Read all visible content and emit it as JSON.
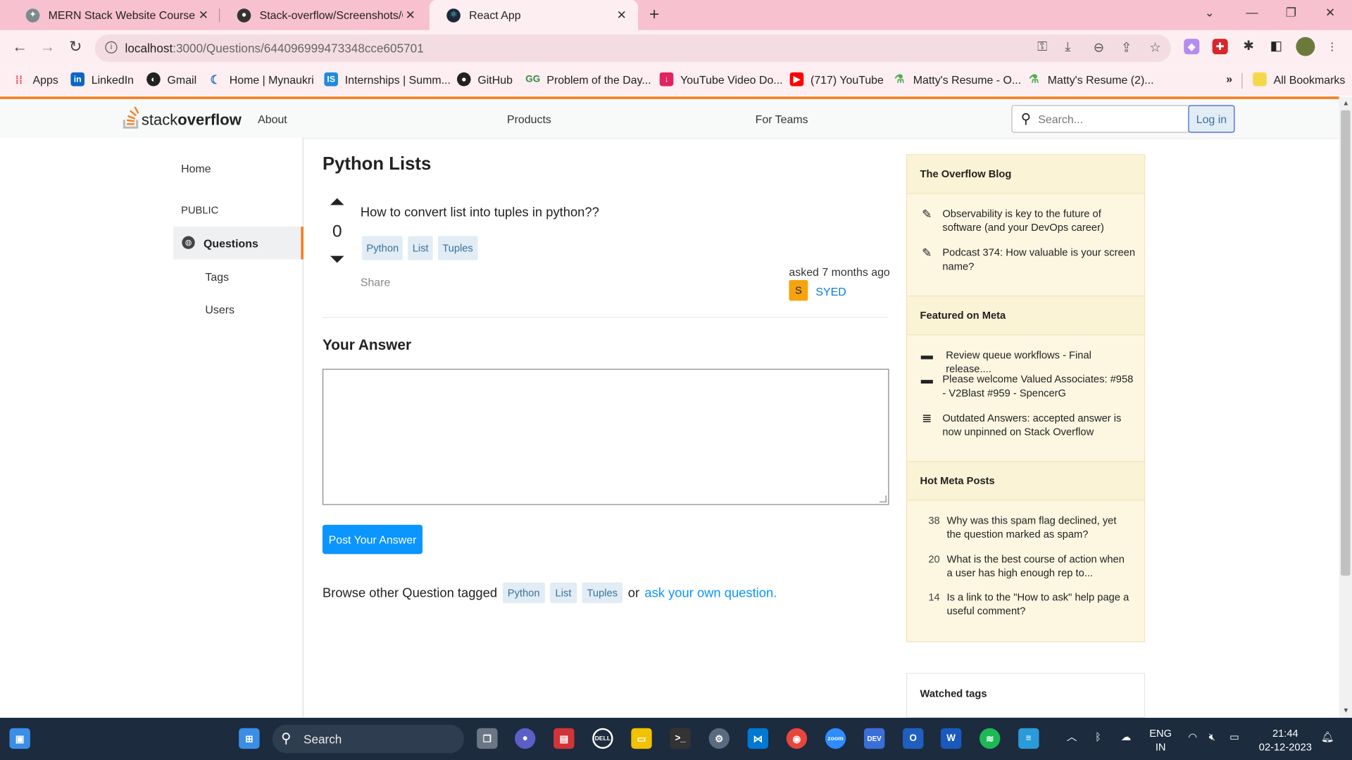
{
  "browser": {
    "tabs": [
      {
        "label": "MERN Stack Website Course",
        "active": false
      },
      {
        "label": "Stack-overflow/Screenshots/Qu",
        "active": false
      },
      {
        "label": "React App",
        "active": true
      }
    ],
    "url_host": "localhost",
    "url_path": ":3000/Questions/644096999473348cce605701",
    "bookmarks": [
      {
        "label": "Apps",
        "icon": "apps-grid-icon"
      },
      {
        "label": "LinkedIn",
        "icon": "linkedin-icon"
      },
      {
        "label": "Gmail",
        "icon": "gmail-icon"
      },
      {
        "label": "Home | Mynaukri",
        "icon": "mynaukri-icon"
      },
      {
        "label": "Internships | Summ...",
        "icon": "internshala-icon"
      },
      {
        "label": "GitHub",
        "icon": "github-icon"
      },
      {
        "label": "Problem of the Day...",
        "icon": "gfg-icon"
      },
      {
        "label": "YouTube Video Do...",
        "icon": "download-icon"
      },
      {
        "label": "(717) YouTube",
        "icon": "youtube-icon"
      },
      {
        "label": "Matty's Resume - O...",
        "icon": "resume-icon"
      },
      {
        "label": "Matty's Resume (2)...",
        "icon": "resume-icon"
      }
    ],
    "all_bookmarks": "All Bookmarks"
  },
  "so_nav": {
    "logo_stack": "stack",
    "logo_overflow": "overflow",
    "about": "About",
    "products": "Products",
    "for_teams": "For Teams",
    "search_placeholder": "Search...",
    "login": "Log in"
  },
  "left_nav": {
    "home": "Home",
    "public": "PUBLIC",
    "questions": "Questions",
    "tags": "Tags",
    "users": "Users"
  },
  "question": {
    "title": "Python Lists",
    "votes": "0",
    "body": "How to convert list into tuples in python??",
    "tags": [
      "Python",
      "List",
      "Tuples"
    ],
    "share": "Share",
    "asked": "asked 7 months ago",
    "user_initial": "S",
    "user_name": "SYED"
  },
  "answer": {
    "heading": "Your Answer",
    "post_button": "Post Your Answer",
    "browse_prefix": "Browse other Question tagged",
    "browse_or": "or",
    "ask_link": "ask your own question."
  },
  "sidebar": {
    "blog_title": "The Overflow Blog",
    "blog_items": [
      "Observability is key to the future of software (and your DevOps career)",
      "Podcast 374: How valuable is your screen name?"
    ],
    "meta_title": "Featured on Meta",
    "meta_items": [
      "Review queue workflows - Final release....",
      "Please welcome Valued Associates: #958 - V2Blast #959 - SpencerG",
      "Outdated Answers: accepted answer is now unpinned on Stack Overflow"
    ],
    "hot_title": "Hot Meta Posts",
    "hot_items": [
      {
        "count": "38",
        "text": "Why was this spam flag declined, yet the question marked as spam?"
      },
      {
        "count": "20",
        "text": "What is the best course of action when a user has high enough rep to..."
      },
      {
        "count": "14",
        "text": "Is a link to the \"How to ask\" help page a useful comment?"
      }
    ],
    "watched_title": "Watched tags"
  },
  "taskbar": {
    "search": "Search",
    "lang1": "ENG",
    "lang2": "IN",
    "time": "21:44",
    "date": "02-12-2023"
  },
  "colors": {
    "accent": "#f48024",
    "link": "#0a95ff",
    "tag_bg": "#e1ecf4",
    "sidebar_bg": "#fdf7e2",
    "tab_bar": "#f8c1cf"
  }
}
